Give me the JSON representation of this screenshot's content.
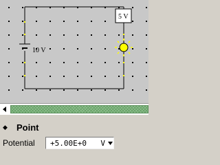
{
  "circuit": {
    "battery_label": "10 V",
    "voltmeter_label": "5 V",
    "wire_color": "#000000",
    "background_color": "#c8c8c8",
    "grid_dot_color": "#000000",
    "node_color": "#ffff00",
    "bulb_color": "#ffff00"
  },
  "scrollbar": {
    "left_arrow_icon": "triangle-left-icon",
    "thumb_color": "#8fc08f"
  },
  "panel": {
    "bullet_icon": "diamond-bullet-icon",
    "title": "Point",
    "property_label": "Potential",
    "property_value": "+5.00E+0",
    "property_unit": "V",
    "dropdown_icon": "chevron-down-icon"
  }
}
